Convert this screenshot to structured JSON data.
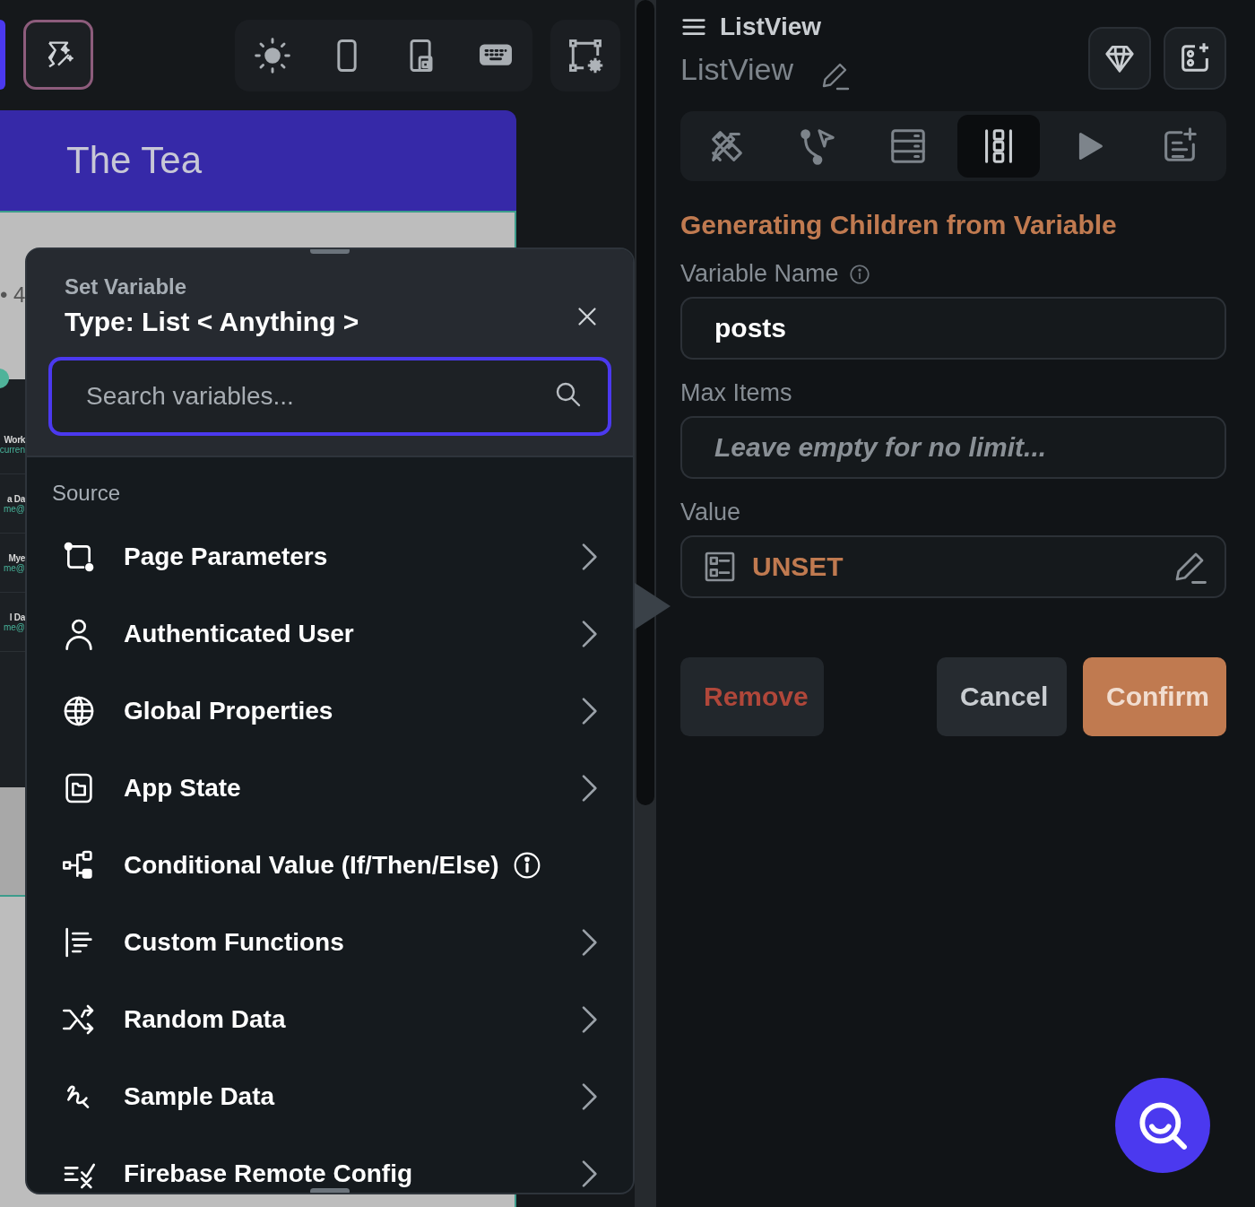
{
  "canvas": {
    "app_bar_title": "The Tea",
    "fragment": "• 4",
    "list_items": [
      {
        "title": "Work",
        "subtitle": "curren"
      },
      {
        "title": "a Da",
        "subtitle": "me@"
      },
      {
        "title": "Mye",
        "subtitle": "me@"
      },
      {
        "title": "l Da",
        "subtitle": "me@"
      }
    ]
  },
  "set_variable": {
    "caption": "Set Variable",
    "title": "Type: List < Anything >",
    "search": {
      "placeholder": "Search variables..."
    },
    "section": "Source",
    "items": [
      {
        "label": "Page Parameters",
        "kind": "submenu"
      },
      {
        "label": "Authenticated User",
        "kind": "submenu"
      },
      {
        "label": "Global Properties",
        "kind": "submenu"
      },
      {
        "label": "App State",
        "kind": "submenu"
      },
      {
        "label": "Conditional Value (If/Then/Else)",
        "kind": "info"
      },
      {
        "label": "Custom Functions",
        "kind": "submenu"
      },
      {
        "label": "Random Data",
        "kind": "submenu"
      },
      {
        "label": "Sample Data",
        "kind": "submenu"
      },
      {
        "label": "Firebase Remote Config",
        "kind": "submenu"
      }
    ]
  },
  "panel": {
    "widget_type": "ListView",
    "widget_name": "ListView",
    "tabs": [
      {
        "selected": false
      },
      {
        "selected": false
      },
      {
        "selected": false
      },
      {
        "selected": true
      },
      {
        "selected": false
      },
      {
        "selected": false
      }
    ],
    "heading": "Generating Children from Variable",
    "variable_name": {
      "label": "Variable Name",
      "value": "posts"
    },
    "max_items": {
      "label": "Max Items",
      "placeholder": "Leave empty for no limit..."
    },
    "value": {
      "label": "Value",
      "value": "UNSET"
    },
    "buttons": [
      {
        "label": "Remove",
        "kind": "danger"
      },
      {
        "label": "Cancel",
        "kind": "secondary"
      },
      {
        "label": "Confirm",
        "kind": "primary"
      }
    ]
  }
}
